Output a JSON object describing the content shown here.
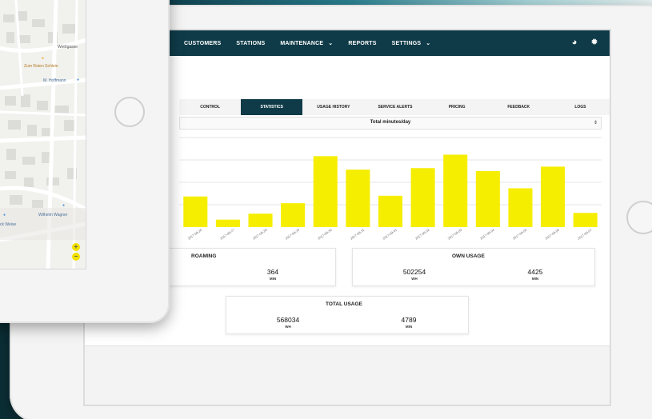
{
  "colors": {
    "nav_bg": "#0f3b48",
    "bar": "#f6ee00",
    "map_pin": "#f6a623",
    "map_pin_blue": "#4a90d9",
    "zoom": "#f3e100"
  },
  "nav": {
    "items": [
      {
        "label": "CUSTOMERS",
        "dropdown": false
      },
      {
        "label": "STATIONS",
        "dropdown": false
      },
      {
        "label": "MAINTENANCE",
        "dropdown": true
      },
      {
        "label": "REPORTS",
        "dropdown": false
      },
      {
        "label": "SETTINGS",
        "dropdown": true
      }
    ],
    "icons": [
      "globe-icon",
      "gear-icon"
    ]
  },
  "tabs": [
    {
      "label": "CONTROL",
      "active": false
    },
    {
      "label": "STATISTICS",
      "active": true
    },
    {
      "label": "USAGE HISTORY",
      "active": false
    },
    {
      "label": "SERVICE ALERTS",
      "active": false
    },
    {
      "label": "PRICING",
      "active": false
    },
    {
      "label": "FEEDBACK",
      "active": false
    },
    {
      "label": "LOGS",
      "active": false
    }
  ],
  "chart_select": {
    "value": "Total minutes/day",
    "arrow": "⇕"
  },
  "chart_data": {
    "type": "bar",
    "title": "Total minutes/day",
    "categories": [
      "2017-08-26",
      "2017-08-27",
      "2017-08-28",
      "2017-08-29",
      "2017-08-30",
      "2017-08-31",
      "2017-09-01",
      "2017-09-02",
      "2017-09-03",
      "2017-09-04",
      "2017-09-05",
      "2017-09-06",
      "2017-09-07"
    ],
    "values": [
      41,
      10,
      18,
      32,
      95,
      77,
      42,
      79,
      97,
      75,
      52,
      81,
      19
    ],
    "ylim": [
      0,
      120
    ],
    "grid": true
  },
  "cards": {
    "roaming": {
      "title": "ROAMING",
      "min_value": "364",
      "min_unit": "MIN"
    },
    "own": {
      "title": "OWN USAGE",
      "wh_value": "502254",
      "wh_unit": "WH",
      "min_value": "4425",
      "min_unit": "MIN"
    },
    "total": {
      "title": "TOTAL USAGE",
      "wh_value": "568034",
      "wh_unit": "WH",
      "min_value": "4789",
      "min_unit": "MIN"
    }
  },
  "map": {
    "labels": {
      "street": "Weißgasse",
      "place1": "Zum Roten Schlein",
      "place2": "M. Hoffmann",
      "place3": "Wilhelm Wagner",
      "place4": "ck Weise"
    },
    "zoom_in": "+",
    "zoom_out": "−"
  }
}
